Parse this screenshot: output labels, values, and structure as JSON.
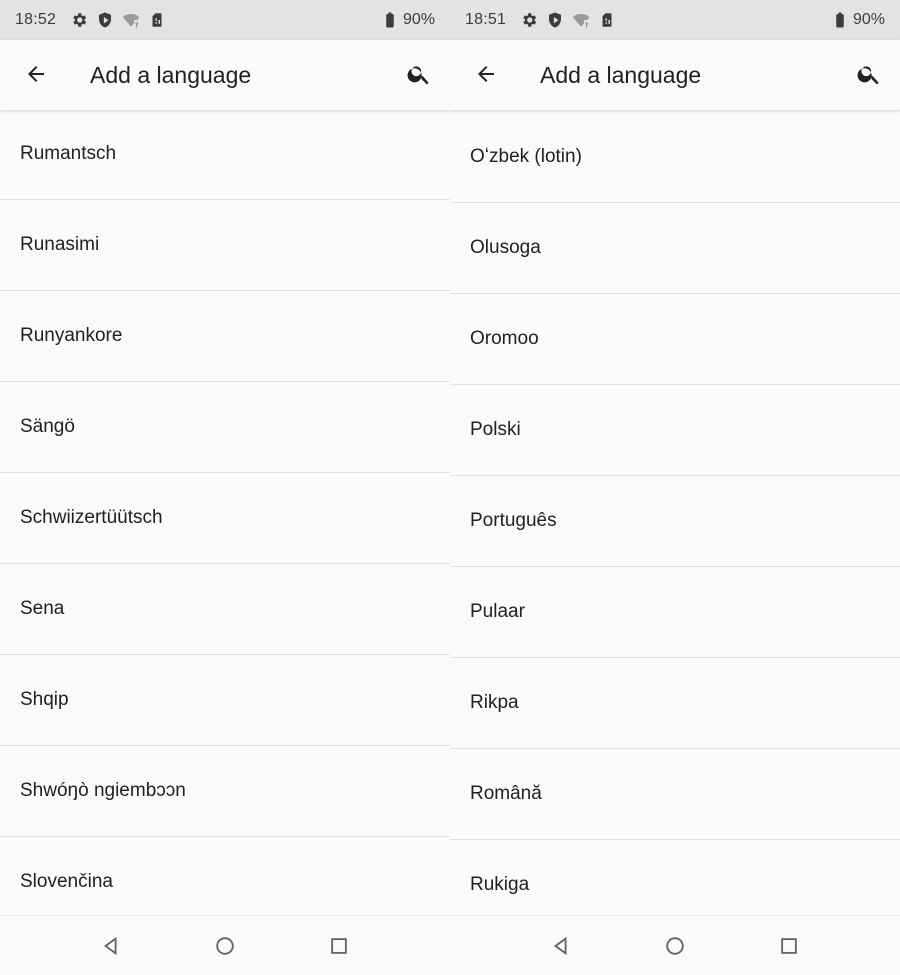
{
  "screens": [
    {
      "status": {
        "time": "18:52",
        "battery": "90%"
      },
      "app_bar": {
        "title": "Add a language"
      },
      "languages": [
        "Rumantsch",
        "Runasimi",
        "Runyankore",
        "Sängö",
        "Schwiizertüütsch",
        "Sena",
        "Shqip",
        "Shwóŋò ngiembɔɔn",
        "Slovenčina"
      ]
    },
    {
      "status": {
        "time": "18:51",
        "battery": "90%"
      },
      "app_bar": {
        "title": "Add a language"
      },
      "languages": [
        "Oʻzbek (lotin)",
        "Olusoga",
        "Oromoo",
        "Polski",
        "Português",
        "Pulaar",
        "Rikpa",
        "Română",
        "Rukiga"
      ]
    }
  ],
  "icons": {
    "status": [
      "settings-icon",
      "shield-icon",
      "wifi-question-icon",
      "sim-card-icon",
      "battery-icon"
    ],
    "app_bar": [
      "back-arrow-icon",
      "search-icon"
    ],
    "nav": [
      "back-triangle-icon",
      "home-circle-icon",
      "recents-square-icon"
    ]
  }
}
